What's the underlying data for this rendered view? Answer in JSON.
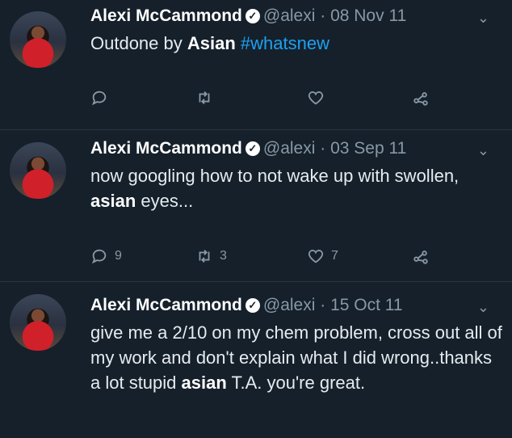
{
  "tweets": [
    {
      "name": "Alexi McCammond",
      "handle": "@alexi",
      "sep": "·",
      "date": "08 Nov 11",
      "text_parts": [
        "Outdone by ",
        "Asian",
        " ",
        "#whatsnew"
      ],
      "replies": "",
      "retweets": "",
      "likes": ""
    },
    {
      "name": "Alexi McCammond",
      "handle": "@alexi",
      "sep": "·",
      "date": "03 Sep 11",
      "text_parts": [
        "now googling how to not wake up with swollen, ",
        "asian",
        " eyes..."
      ],
      "replies": "9",
      "retweets": "3",
      "likes": "7"
    },
    {
      "name": "Alexi McCammond",
      "handle": "@alexi",
      "sep": "·",
      "date": "15 Oct 11",
      "text_parts": [
        "give me a 2/10 on my chem problem, cross out all of my work and don't explain what I did wrong..thanks a lot stupid ",
        "asian",
        " T.A. you're great."
      ],
      "replies": "",
      "retweets": "",
      "likes": ""
    }
  ],
  "icons": {
    "verified": "verified-check-icon",
    "menu": "chevron-down-icon",
    "reply": "reply-icon",
    "retweet": "retweet-icon",
    "like": "heart-icon",
    "share": "share-icon"
  },
  "colors": {
    "background": "#15202b",
    "hashtag": "#1da1f2",
    "muted": "#8899a6"
  }
}
